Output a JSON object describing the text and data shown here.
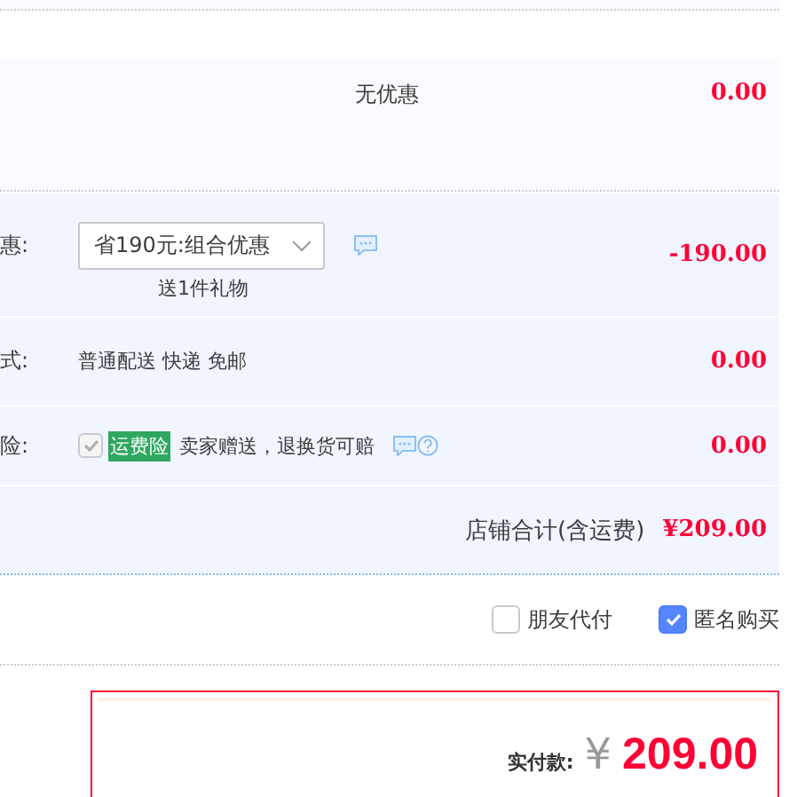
{
  "promo": {
    "text": "无优惠",
    "amount": "0.00"
  },
  "discount": {
    "label": "惠:",
    "select": "省190元:组合优惠",
    "gift": "送1件礼物",
    "amount": "-190.00"
  },
  "shipping": {
    "label": "式:",
    "method": "普通配送 快递 免邮",
    "amount": "0.00"
  },
  "insurance": {
    "label": "险:",
    "checked": true,
    "disabled": true,
    "tag": "运费险",
    "text": "卖家赠送，退换货可赔",
    "amount": "0.00"
  },
  "subtotal": {
    "label": "店铺合计(含运费)",
    "amount": "¥209.00"
  },
  "options": [
    {
      "label": "朋友代付",
      "checked": false
    },
    {
      "label": "匿名购买",
      "checked": true
    }
  ],
  "payment": {
    "label": "实付款:",
    "currency": "¥",
    "amount": "209.00"
  }
}
